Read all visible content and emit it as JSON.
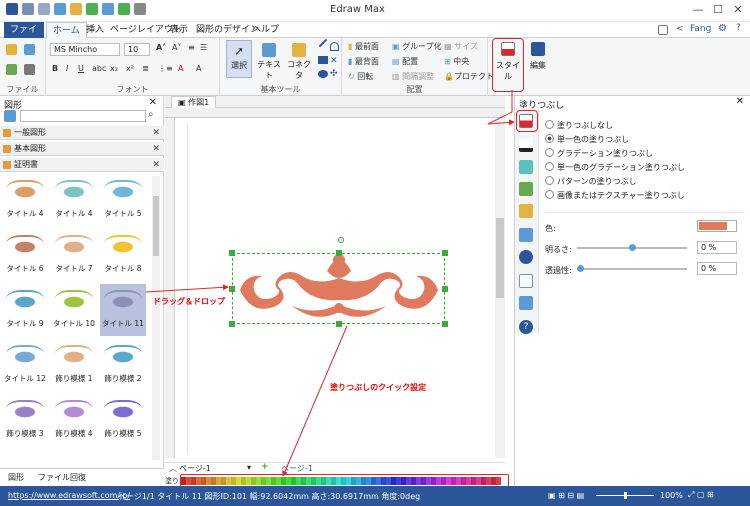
{
  "app": {
    "title": "Edraw Max",
    "user": "Fang"
  },
  "menu": {
    "file": "ファイル",
    "tabs": [
      "ホーム",
      "挿入",
      "ページレイアウト",
      "表示",
      "図形のデザイン",
      "ヘルプ"
    ]
  },
  "ribbon": {
    "font_name": "MS Mincho",
    "font_size": "10",
    "select": "選択",
    "text": "テキスト",
    "connector": "コネクタ",
    "front": "最前面",
    "back": "最背面",
    "group": "グループ化",
    "arrange": "配置",
    "rotate": "回転",
    "spacing": "間隔調整",
    "size": "サイズ",
    "center": "中央",
    "protect": "プロテクト",
    "style": "スタイル",
    "edit": "編集",
    "groups": {
      "file": "ファイル",
      "font": "フォント",
      "basic": "基本ツール",
      "arrange": "配置"
    }
  },
  "left": {
    "header": "図形",
    "search_placeholder": "",
    "libs": [
      "一般図形",
      "基本図形",
      "証明書"
    ],
    "items": [
      "タイトル 4",
      "タイトル 4",
      "タイトル 5",
      "タイトル 6",
      "タイトル 7",
      "タイトル 8",
      "タイトル 9",
      "タイトル 10",
      "タイトル 11",
      "タイトル 12",
      "飾り模様 1",
      "飾り模様 2",
      "飾り模様 3",
      "飾り模様 4",
      "飾り模様 5"
    ],
    "bottom_tabs": [
      "図形",
      "ファイル回復"
    ]
  },
  "canvas": {
    "doc_tab": "作図1",
    "page": "ページ-1",
    "page_tab": "ページ-1"
  },
  "fill": {
    "title": "塗りつぶし",
    "options": [
      "塗りつぶしなし",
      "単一色の塗りつぶし",
      "グラデーション塗りつぶし",
      "単一色のグラデーション塗りつぶし",
      "パターンの塗りつぶし",
      "画像またはテクスチャー塗りつぶし"
    ],
    "selected": 1,
    "color_label": "色:",
    "brightness_label": "明るさ:",
    "transparency_label": "透過性:",
    "brightness": "0 %",
    "transparency": "0 %",
    "color": "#e07a5f"
  },
  "annotations": {
    "drag": "ドラッグ＆ドロップ",
    "quick": "塗りつぶしのクイック設定"
  },
  "status": {
    "url": "https://www.edrawsoft.com/jp/",
    "info": "ページ1/1  タイトル 11  図形ID:101  幅:92.6042mm  高さ:30.6917mm  角度:0deg",
    "zoom": "100%"
  },
  "palette_label": "塗りつ"
}
